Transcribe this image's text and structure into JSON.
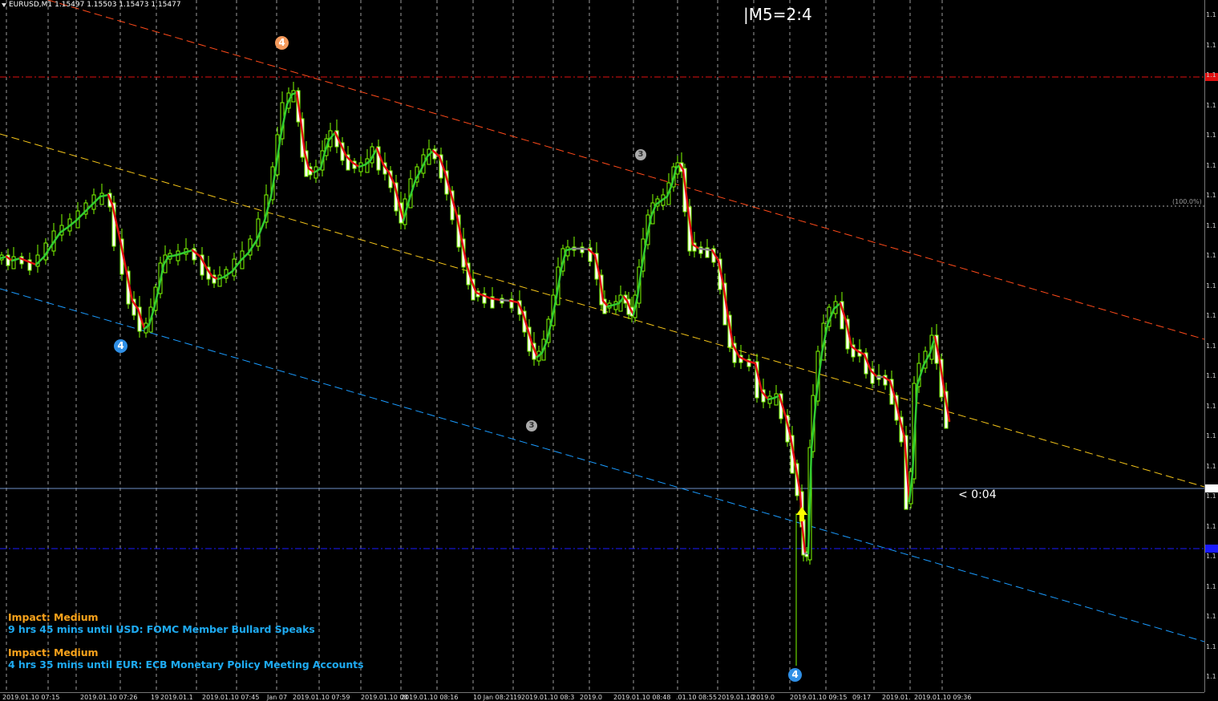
{
  "window": {
    "symbol_label": "EURUSD,M1",
    "ohlc": "1.15497 1.15503 1.15473 1.15477"
  },
  "overlay": {
    "period_label": "|M5=2:4",
    "countdown": "< 0:04",
    "fib_label": "(100.0%)"
  },
  "news": [
    {
      "impact": "Impact: Medium",
      "event": "9 hrs 45 mins until USD: FOMC Member Bullard Speaks"
    },
    {
      "impact": "Impact: Medium",
      "event": "4 hrs 35 mins until EUR: ECB Monetary Policy Meeting Accounts"
    }
  ],
  "wave_markers": [
    {
      "label": "4",
      "color": "#f49a5c"
    },
    {
      "label": "4",
      "color": "#2f8fe6"
    },
    {
      "label": "3",
      "color": "#aaaaaa"
    },
    {
      "label": "3",
      "color": "#aaaaaa"
    },
    {
      "label": "4",
      "color": "#2f8fe6"
    }
  ],
  "price_axis": {
    "ticks": [
      "1.1",
      "1.1",
      "1.1",
      "1.1",
      "1.1",
      "1.1",
      "1.1",
      "1.1",
      "1.1",
      "1.1",
      "1.1",
      "1.1",
      "1.1",
      "1.1",
      "1.1",
      "1.1",
      "1.1",
      "1.1",
      "1.1",
      "1.1",
      "1.1",
      "1.1",
      "1.1"
    ],
    "current_price_label": "1.1",
    "red_level_label": "1.1",
    "blue_level_label": "1.1"
  },
  "time_axis": {
    "labels": [
      "2019.01.10 07:15",
      "2019.01.10 07:26",
      "19",
      "2019.01.1",
      "2019.01.10 07:45",
      "Jan 07",
      "2019.01.10 07:59",
      "2019.01.10 08",
      "2019.01.10 08:16",
      "10 Jan 08:21",
      "19",
      "2019.01.10 08:3",
      "2019.0",
      "2019.01.10 08:48",
      ".01.10 08:55",
      "2019.01.10",
      "2019.0",
      "2019.01.10 09:15",
      "09:17",
      "2019.01.",
      "2019.01.10 09:36"
    ]
  },
  "colors": {
    "background": "#000000",
    "bull_candle": "#7fff00",
    "bear_candle": "#ffffff",
    "ma_up": "#32cd32",
    "ma_down": "#e01010",
    "ma_flat": "#808080",
    "channel_top": "#ff4a1a",
    "channel_mid": "#f5c518",
    "channel_bottom": "#1a9bff",
    "resistance": "#e01010",
    "support": "#1a1aff",
    "grid": "#d0d0d0",
    "signal_arrow": "#ffff00"
  },
  "icons": {
    "signal_arrow": "arrow-up-icon",
    "dropdown": "triangle-down-icon"
  }
}
